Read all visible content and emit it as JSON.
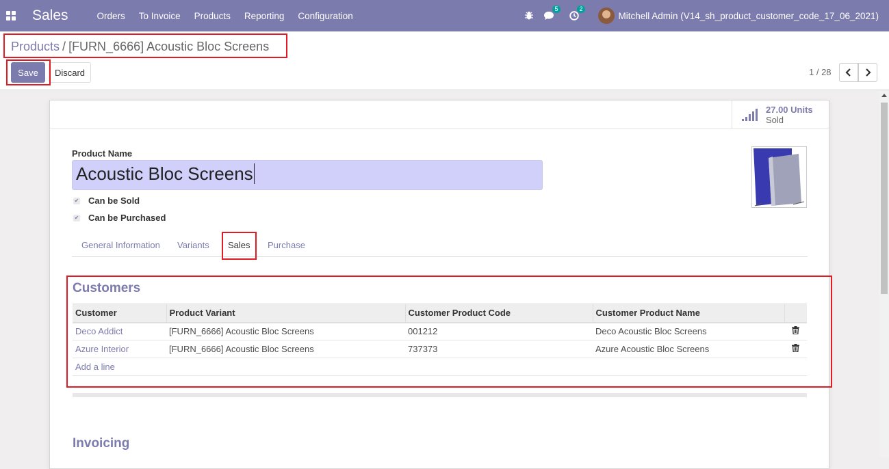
{
  "navbar": {
    "app_name": "Sales",
    "menu": [
      "Orders",
      "To Invoice",
      "Products",
      "Reporting",
      "Configuration"
    ],
    "messages_count": "5",
    "activities_count": "2",
    "user": "Mitchell Admin (V14_sh_product_customer_code_17_06_2021)"
  },
  "breadcrumb": {
    "parent": "Products",
    "separator": "/",
    "current": "[FURN_6666] Acoustic Bloc Screens"
  },
  "actions": {
    "save": "Save",
    "discard": "Discard"
  },
  "pager": {
    "value": "1 / 28"
  },
  "stat_button": {
    "value": "27.00 Units",
    "label": "Sold"
  },
  "form": {
    "name_label": "Product Name",
    "name_value": "Acoustic Bloc Screens",
    "can_be_sold": "Can be Sold",
    "can_be_purchased": "Can be Purchased"
  },
  "tabs": [
    "General Information",
    "Variants",
    "Sales",
    "Purchase"
  ],
  "active_tab": "Sales",
  "customers": {
    "title": "Customers",
    "columns": [
      "Customer",
      "Product Variant",
      "Customer Product Code",
      "Customer Product Name"
    ],
    "rows": [
      [
        "Deco Addict",
        "[FURN_6666] Acoustic Bloc Screens",
        "001212",
        "Deco Acoustic Bloc Screens"
      ],
      [
        "Azure Interior",
        "[FURN_6666] Acoustic Bloc Screens",
        "737373",
        "Azure Acoustic Bloc Screens"
      ]
    ],
    "add_line": "Add a line"
  },
  "invoicing": {
    "title": "Invoicing"
  },
  "colors": {
    "brand": "#7c7bad",
    "highlight": "#e01b24",
    "input_bg": "#d0d0fb"
  }
}
